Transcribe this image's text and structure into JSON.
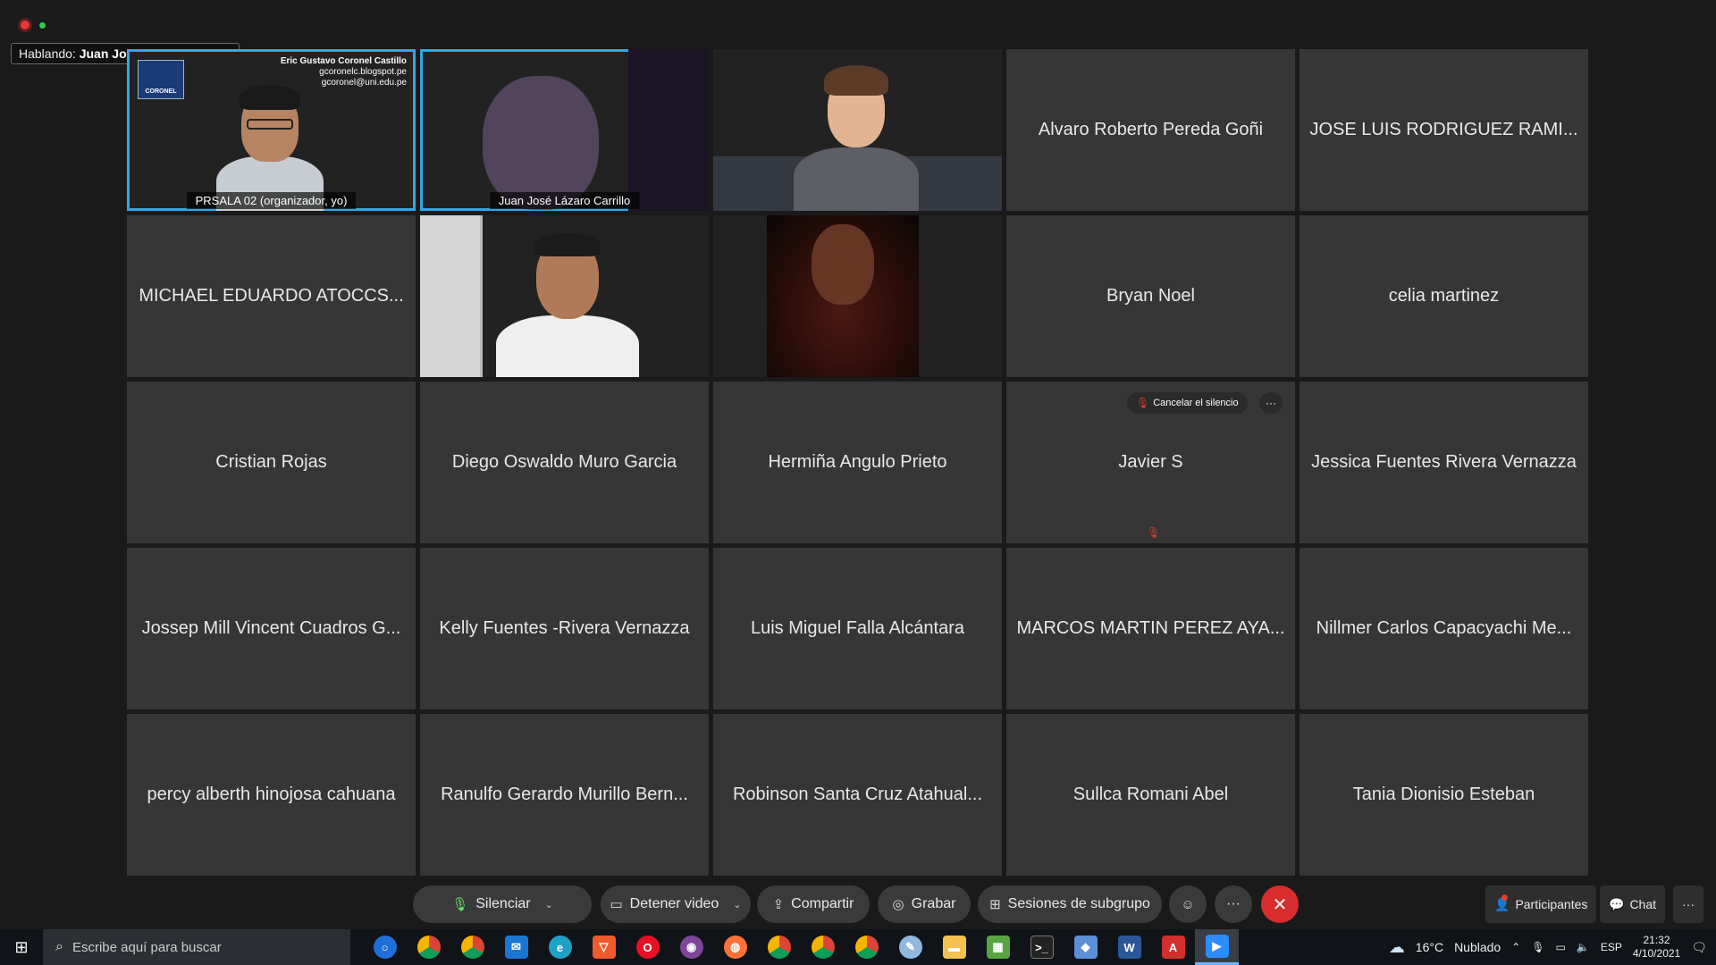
{
  "speaking": {
    "prefix": "Hablando:",
    "name": "Juan José Lázaro Carrillo"
  },
  "tiles": {
    "t1": {
      "badge": "PRSALA 02  (organizador, yo)",
      "overlay_title": "Eric Gustavo Coronel Castillo",
      "overlay_line2": "gcoronelc.blogspot.pe",
      "overlay_line3": "gcoronel@uni.edu.pe",
      "logo_text": "CORONEL"
    },
    "t2": {
      "badge": "Juan José Lázaro Carrillo"
    },
    "t4": {
      "name": "Alvaro Roberto Pereda Goñi"
    },
    "t5": {
      "name": "JOSE LUIS RODRIGUEZ RAMI..."
    },
    "t6": {
      "name": "MICHAEL EDUARDO ATOCCS..."
    },
    "t9": {
      "name": "Bryan Noel"
    },
    "t10": {
      "name": "celia martinez"
    },
    "t11": {
      "name": "Cristian Rojas"
    },
    "t12": {
      "name": "Diego Oswaldo Muro Garcia"
    },
    "t13": {
      "name": "Hermiña Angulo Prieto"
    },
    "t14": {
      "name": "Javier S",
      "unmute_label": "Cancelar el silencio",
      "more_label": "···"
    },
    "t15": {
      "name": "Jessica Fuentes Rivera Vernazza"
    },
    "t16": {
      "name": "Jossep Mill Vincent Cuadros G..."
    },
    "t17": {
      "name": "Kelly Fuentes -Rivera Vernazza"
    },
    "t18": {
      "name": "Luis Miguel Falla Alcántara"
    },
    "t19": {
      "name": "MARCOS MARTIN PEREZ AYA..."
    },
    "t20": {
      "name": "Nillmer Carlos Capacyachi Me..."
    },
    "t21": {
      "name": "percy alberth hinojosa cahuana"
    },
    "t22": {
      "name": "Ranulfo Gerardo Murillo Bern..."
    },
    "t23": {
      "name": "Robinson Santa Cruz Atahual..."
    },
    "t24": {
      "name": "Sullca Romani Abel"
    },
    "t25": {
      "name": "Tania Dionisio Esteban"
    }
  },
  "toolbar": {
    "mute": "Silenciar",
    "video": "Detener video",
    "share": "Compartir",
    "record": "Grabar",
    "breakout": "Sesiones de subgrupo",
    "more": "···",
    "participants": "Participantes",
    "chat": "Chat",
    "right_more": "···"
  },
  "taskbar": {
    "search_placeholder": "Escribe aquí para buscar",
    "temperature": "16°C",
    "weather": "Nublado",
    "lang": "ESP",
    "time": "21:32",
    "date": "4/10/2021"
  },
  "colors": {
    "active_border": "#2fa8e6",
    "leave_red": "#d92c2c",
    "tile_bg": "#363636"
  }
}
